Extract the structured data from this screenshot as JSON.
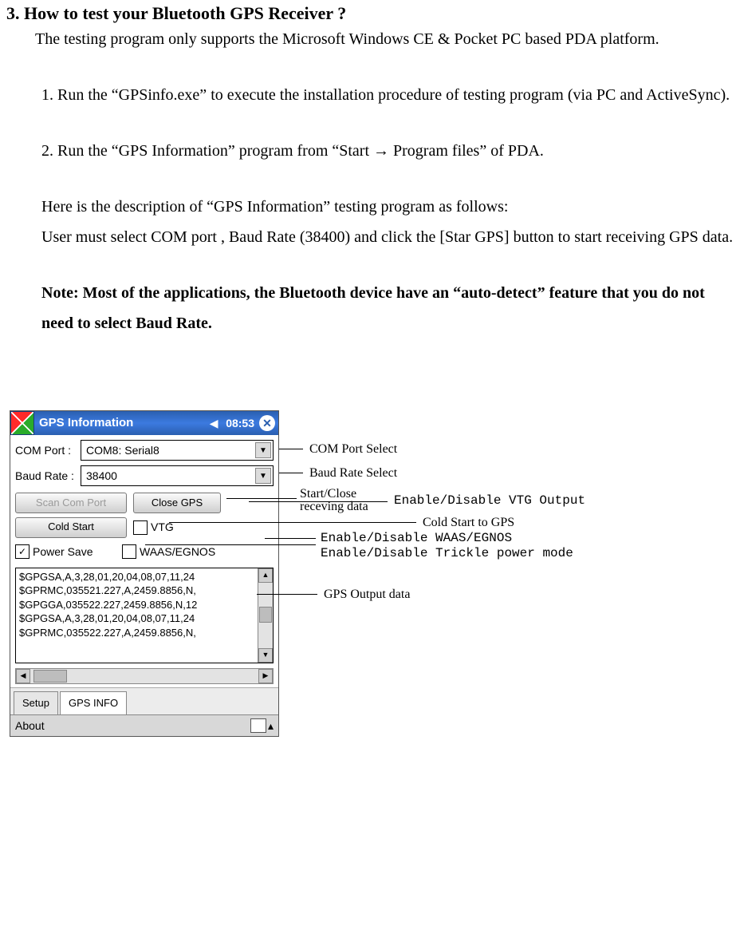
{
  "heading": "3. How to test your Bluetooth GPS Receiver ?",
  "intro": "The testing program only supports the Microsoft Windows CE & Pocket PC based PDA platform.",
  "step1": "1. Run the “GPSinfo.exe” to execute the installation procedure of testing program (via PC and ActiveSync).",
  "step2": "2. Run the “GPS Information” program from “Start → Program files” of PDA.",
  "desc1": "Here is the description of “GPS Information” testing program as follows:",
  "desc2": "User must select COM port , Baud Rate (38400) and click the [Star GPS] button to start receiving GPS data.",
  "note": "Note: Most of the applications, the Bluetooth device have an “auto-detect” feature that you do not need to select Baud Rate.",
  "pda": {
    "title": "GPS Information",
    "time": "08:53",
    "comport_label": "COM Port :",
    "comport_value": "COM8: Serial8",
    "baud_label": "Baud Rate :",
    "baud_value": "38400",
    "btn_scan": "Scan Com Port",
    "btn_close": "Close GPS",
    "btn_cold": "Cold Start",
    "cb_vtg": "VTG",
    "cb_power": "Power Save",
    "cb_waas": "WAAS/EGNOS",
    "nmea": [
      "$GPGSA,A,3,28,01,20,04,08,07,11,24",
      "$GPRMC,035521.227,A,2459.8856,N,",
      "$GPGGA,035522.227,2459.8856,N,12",
      "$GPGSA,A,3,28,01,20,04,08,07,11,24",
      "$GPRMC,035522.227,A,2459.8856,N,"
    ],
    "tab_setup": "Setup",
    "tab_info": "GPS INFO",
    "about": "About"
  },
  "ann": {
    "comsel": "COM Port Select",
    "baudsel": "Baud Rate Select",
    "startclose1": "Start/Close",
    "startclose2": "receving data",
    "vtg": "Enable/Disable VTG Output",
    "cold": "Cold Start to GPS",
    "waas": "Enable/Disable WAAS/EGNOS",
    "trickle": "Enable/Disable Trickle power mode",
    "output": "GPS Output data"
  }
}
